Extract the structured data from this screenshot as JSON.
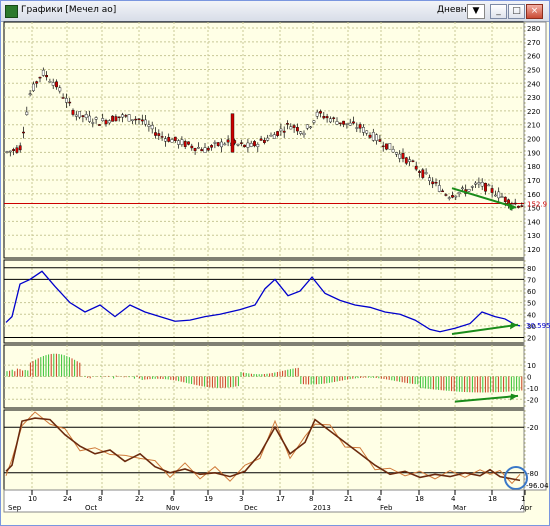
{
  "window": {
    "title": "Графики [Мечел ао]",
    "period": "Дневной",
    "period_icon": "arrow-down-icon",
    "buttons": [
      "minimize-icon",
      "maximize-icon",
      "restore-icon",
      "close-icon"
    ]
  },
  "colors": {
    "background": "#ffffe6",
    "grid": "#c8c896",
    "up_candle": "#ffffff",
    "down_candle": "#cc0000",
    "rsi_line": "#0000cc",
    "divergence_arrow": "#1a8c1a",
    "price_line": "#cc0000",
    "highlight_circle": "#3a78c8"
  },
  "price_panel": {
    "y_ticks": [
      "280",
      "270",
      "260",
      "250",
      "240",
      "230",
      "220",
      "210",
      "200",
      "190",
      "180",
      "170",
      "160",
      "150",
      "140",
      "130",
      "120"
    ],
    "current_price_label": "152.9"
  },
  "rsi_panel": {
    "y_ticks": [
      "80",
      "70",
      "60",
      "50",
      "40",
      "30",
      "20"
    ],
    "current_value_label": "30.595"
  },
  "macd_panel": {
    "y_ticks": [
      "10",
      "0",
      "-10",
      "-20"
    ]
  },
  "stoch_panel": {
    "y_ticks": [
      "-20",
      "-80"
    ],
    "current_value_label": "-96.04"
  },
  "x_axis": {
    "day_labels": [
      "10",
      "24",
      "8",
      "22",
      "6",
      "19",
      "3",
      "17",
      "8",
      "21",
      "4",
      "18",
      "4",
      "18",
      "1"
    ],
    "month_labels": [
      "Sep",
      "Oct",
      "Nov",
      "Dec",
      "2013",
      "Feb",
      "Mar",
      "Apr"
    ]
  }
}
